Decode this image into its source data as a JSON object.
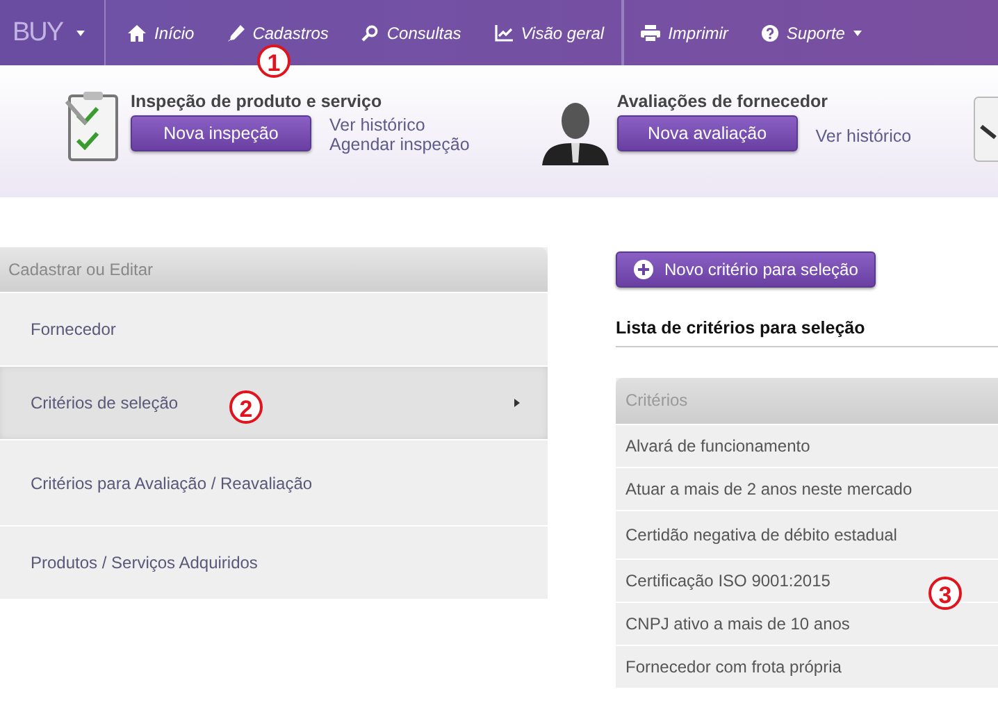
{
  "navbar": {
    "brand": "BUY",
    "items": [
      {
        "label": "Início",
        "dropdown": false
      },
      {
        "label": "Cadastros",
        "dropdown": false
      },
      {
        "label": "Consultas",
        "dropdown": false
      },
      {
        "label": "Visão geral",
        "dropdown": false
      },
      {
        "label": "Imprimir",
        "dropdown": false
      },
      {
        "label": "Suporte",
        "dropdown": true
      }
    ]
  },
  "quick_actions": [
    {
      "title": "Inspeção de produto e serviço",
      "button": "Nova inspeção",
      "links": [
        "Ver histórico",
        "Agendar inspeção"
      ]
    },
    {
      "title": "Avaliações de fornecedor",
      "button": "Nova avaliação",
      "links": [
        "Ver histórico"
      ]
    }
  ],
  "sidebar": {
    "title": "Cadastrar ou Editar",
    "items": [
      {
        "label": "Fornecedor",
        "selected": false
      },
      {
        "label": "Critérios de seleção",
        "selected": true
      },
      {
        "label": "Critérios para Avaliação / Reavaliação",
        "selected": false
      },
      {
        "label": "Produtos / Serviços Adquiridos",
        "selected": false
      }
    ]
  },
  "content": {
    "new_button": "Novo critério para seleção",
    "heading": "Lista de critérios para seleção",
    "table": {
      "columns": [
        "Critérios"
      ],
      "rows": [
        "Alvará de funcionamento",
        "Atuar a mais de 2 anos neste mercado",
        "Certidão negativa de débito estadual",
        "Certificação ISO 9001:2015",
        "CNPJ ativo a mais de 10 anos",
        "Fornecedor com frota própria"
      ]
    }
  },
  "annotations": [
    "1",
    "2",
    "3"
  ]
}
